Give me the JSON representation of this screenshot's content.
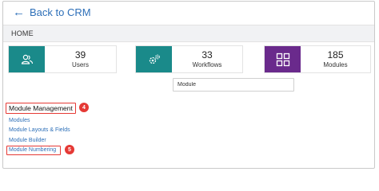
{
  "header": {
    "back_label": "Back to CRM"
  },
  "breadcrumb": {
    "label": "HOME"
  },
  "cards": [
    {
      "count": "39",
      "label": "Users",
      "color": "#1a8a8a",
      "icon": "users-icon"
    },
    {
      "count": "33",
      "label": "Workflows",
      "color": "#1a8a8a",
      "icon": "workflow-gear-icon"
    },
    {
      "count": "185",
      "label": "Modules",
      "color": "#6a2a8c",
      "icon": "grid-icon"
    }
  ],
  "search": {
    "value": "Module"
  },
  "section": {
    "title": "Module Management",
    "badge": "4"
  },
  "links": [
    {
      "label": "Modules"
    },
    {
      "label": "Module Layouts & Fields"
    },
    {
      "label": "Module Builder"
    },
    {
      "label": "Module Numbering",
      "badge": "5"
    }
  ],
  "colors": {
    "accent_link": "#2d6fb8",
    "highlight": "#e53935"
  }
}
